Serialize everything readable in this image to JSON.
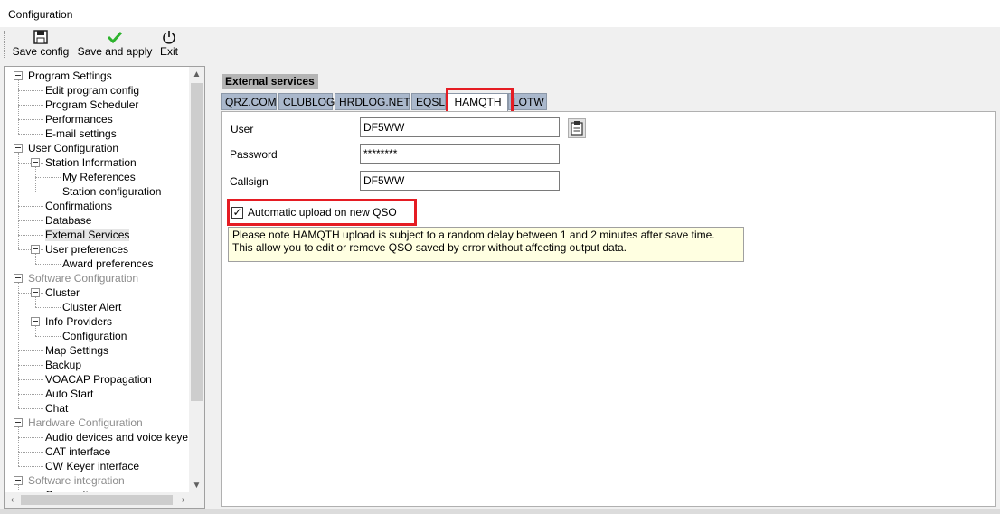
{
  "window": {
    "title": "Configuration"
  },
  "toolbar": {
    "save_config": {
      "label": "Save config",
      "icon": "floppy-disk-icon"
    },
    "save_apply": {
      "label": "Save and apply",
      "icon": "green-check-icon"
    },
    "exit": {
      "label": "Exit",
      "icon": "power-icon"
    }
  },
  "tree": {
    "items": [
      {
        "label": "Program Settings",
        "level": 0,
        "expanded": true,
        "disabled": false
      },
      {
        "label": "Edit program config",
        "level": 1
      },
      {
        "label": "Program Scheduler",
        "level": 1
      },
      {
        "label": "Performances",
        "level": 1
      },
      {
        "label": "E-mail settings",
        "level": 1
      },
      {
        "label": "User Configuration",
        "level": 0,
        "expanded": true,
        "disabled": false
      },
      {
        "label": "Station Information",
        "level": 1,
        "expanded": true
      },
      {
        "label": "My References",
        "level": 2
      },
      {
        "label": "Station configuration",
        "level": 2
      },
      {
        "label": "Confirmations",
        "level": 1
      },
      {
        "label": "Database",
        "level": 1
      },
      {
        "label": "External Services",
        "level": 1,
        "selected": true
      },
      {
        "label": "User preferences",
        "level": 1,
        "expanded": true
      },
      {
        "label": "Award preferences",
        "level": 2
      },
      {
        "label": "Software Configuration",
        "level": 0,
        "expanded": true,
        "disabled": true
      },
      {
        "label": "Cluster",
        "level": 1,
        "expanded": true
      },
      {
        "label": "Cluster Alert",
        "level": 2
      },
      {
        "label": "Info Providers",
        "level": 1,
        "expanded": true
      },
      {
        "label": "Configuration",
        "level": 2
      },
      {
        "label": "Map Settings",
        "level": 1
      },
      {
        "label": "Backup",
        "level": 1
      },
      {
        "label": "VOACAP Propagation",
        "level": 1
      },
      {
        "label": "Auto Start",
        "level": 1
      },
      {
        "label": "Chat",
        "level": 1
      },
      {
        "label": "Hardware Configuration",
        "level": 0,
        "expanded": true,
        "disabled": true
      },
      {
        "label": "Audio devices and voice keye",
        "level": 1
      },
      {
        "label": "CAT interface",
        "level": 1
      },
      {
        "label": "CW Keyer interface",
        "level": 1
      },
      {
        "label": "Software integration",
        "level": 0,
        "expanded": true,
        "disabled": true
      },
      {
        "label": "Connections",
        "level": 1
      }
    ]
  },
  "main": {
    "section_title": "External services",
    "tabs": [
      {
        "label": "QRZ.COM"
      },
      {
        "label": "CLUBLOG"
      },
      {
        "label": "HRDLOG.NET"
      },
      {
        "label": "EQSL"
      },
      {
        "label": "HAMQTH",
        "active": true
      },
      {
        "label": "LOTW"
      }
    ],
    "user": {
      "label": "User",
      "value": "DF5WW"
    },
    "password": {
      "label": "Password",
      "value": "********"
    },
    "callsign": {
      "label": "Callsign",
      "value": "DF5WW"
    },
    "auto_upload": {
      "label": "Automatic upload on new QSO",
      "checked": true,
      "mark": "✓"
    },
    "note": {
      "line1": "Please note HAMQTH upload is subject to a random delay between 1 and 2 minutes after save time.",
      "line2": "This allow you to edit or remove QSO saved by error without affecting output data."
    }
  },
  "colors": {
    "highlight": "#e51c23",
    "tab_inactive": "#aab8cc",
    "note_bg": "#ffffe1"
  }
}
